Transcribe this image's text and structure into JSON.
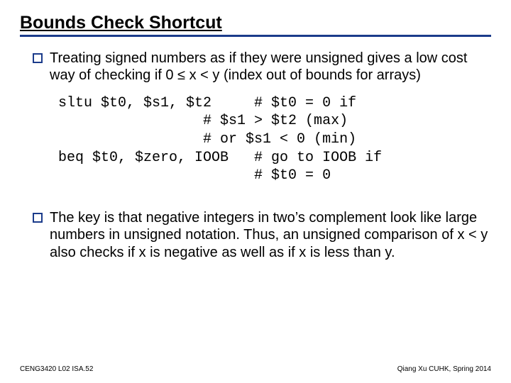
{
  "title": "Bounds Check Shortcut",
  "bullets": [
    "Treating signed numbers as if they were unsigned gives a low cost way of checking if 0 ≤ x < y (index out of bounds for arrays)",
    "The key is that negative integers in two’s complement look like large numbers in unsigned notation.  Thus, an unsigned comparison of x < y also checks if x is negative as well as if x is less than y."
  ],
  "code": " sltu $t0, $s1, $t2     # $t0 = 0 if\n                  # $s1 > $t2 (max)\n                  # or $s1 < 0 (min)\n beq $t0, $zero, IOOB   # go to IOOB if\n                        # $t0 = 0",
  "footer": {
    "left": "CENG3420 L02 ISA.52",
    "right": "Qiang Xu   CUHK, Spring 2014"
  }
}
